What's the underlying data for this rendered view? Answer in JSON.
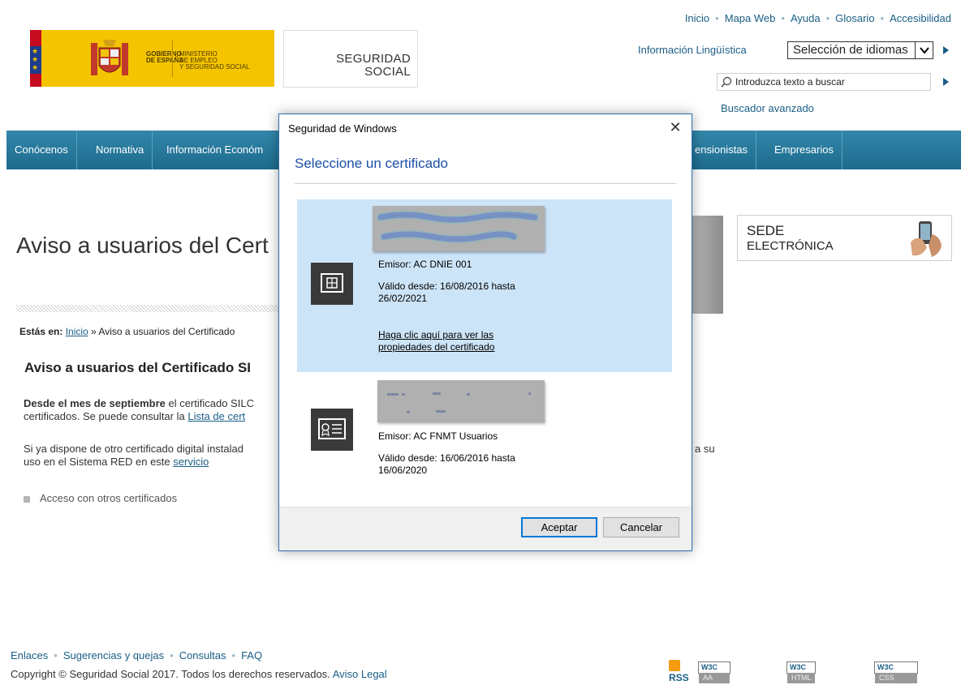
{
  "header": {
    "toplinks": [
      "Inicio",
      "Mapa Web",
      "Ayuda",
      "Glosario",
      "Accesibilidad"
    ],
    "gobierno_logo": [
      "GOBIERNO",
      "DE ESPAÑA"
    ],
    "ministerio_logo": [
      "MINISTERIO",
      "DE EMPLEO",
      "Y SEGURIDAD SOCIAL"
    ],
    "ss_logo": [
      "SEGURIDAD",
      "SOCIAL"
    ],
    "info_linguistica": "Información Lingüística",
    "language_select_value": "Selección de idiomas",
    "search_placeholder": "Introduzca texto a buscar",
    "buscador_avanzado": "Buscador avanzado"
  },
  "nav": {
    "items": [
      "Conócenos",
      "Normativa",
      "Información Económ",
      "ensionistas",
      "Empresarios"
    ]
  },
  "main": {
    "title": "Aviso a usuarios del Cert",
    "breadcrumb_label": "Estás en:",
    "breadcrumb_home": "Inicio",
    "breadcrumb_current": "» Aviso a usuarios del Certificado",
    "subtitle": "Aviso a usuarios del Certificado SI",
    "p1_bold": "Desde el mes de septiembre",
    "p1_rest": " el certificado SILC",
    "p1_line2": "certificados. Se puede consultar la ",
    "p1_link": "Lista de cert",
    "p2_line1": "Si ya dispone de otro certificado digital instalad",
    "p2_right": "a su",
    "p2_line2": "uso en el Sistema RED en este ",
    "p2_link": "servicio",
    "bullet": "Acceso con otros certificados",
    "sede": [
      "SEDE",
      "ELECTRÓNICA"
    ]
  },
  "footer": {
    "links": [
      "Enlaces",
      "Sugerencias y quejas",
      "Consultas",
      "FAQ"
    ],
    "copyright": "Copyright © Seguridad Social 2017. Todos los derechos reservados. ",
    "aviso_legal": "Aviso Legal",
    "rss": "RSS",
    "badges": [
      {
        "w": "W3C",
        "t": "AA WCAG"
      },
      {
        "w": "W3C",
        "t": "HTML 4.0"
      },
      {
        "w": "W3C",
        "t": "CSS"
      }
    ]
  },
  "dialog": {
    "title": "Seguridad de Windows",
    "close": "✕",
    "heading": "Seleccione un certificado",
    "certs": [
      {
        "emisor": "Emisor: AC DNIE 001",
        "valido1": "Válido desde: 16/08/2016 hasta",
        "valido2": "26/02/2021",
        "link1": "Haga clic aquí para ver las",
        "link2": "propiedades del certificado"
      },
      {
        "emisor": "Emisor: AC FNMT Usuarios",
        "valido1": "Válido desde: 16/06/2016 hasta",
        "valido2": "16/06/2020"
      }
    ],
    "ok": "Aceptar",
    "cancel": "Cancelar"
  }
}
